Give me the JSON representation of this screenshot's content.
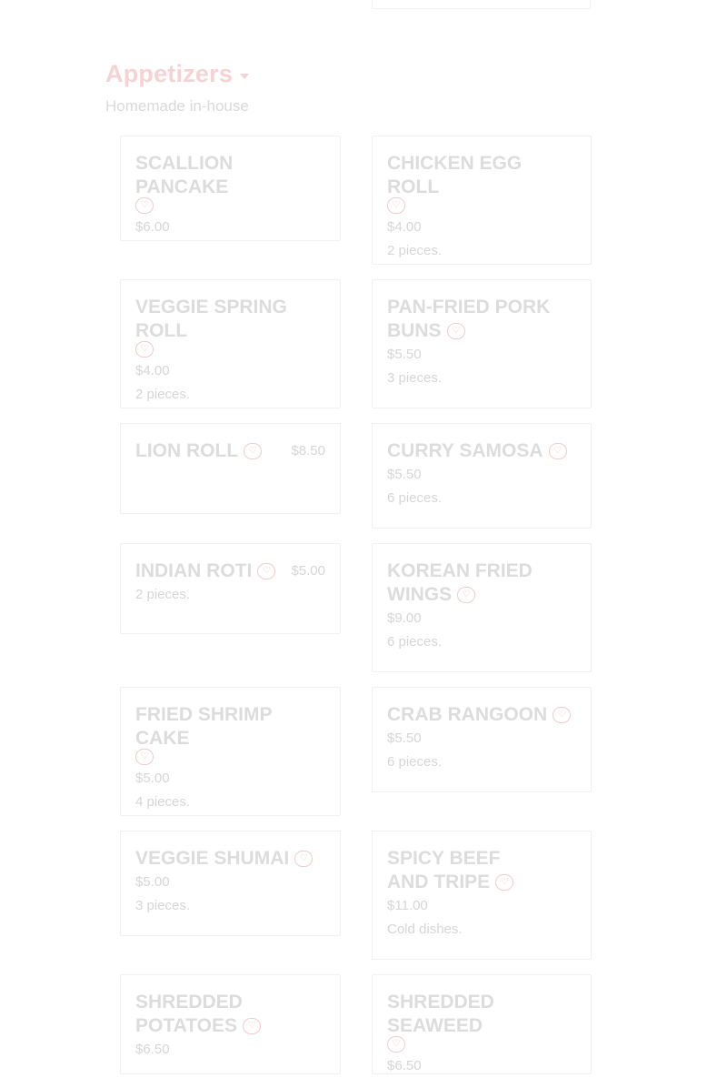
{
  "section": {
    "title": "Appetizers",
    "subtitle": "Homemade in-house"
  },
  "items": [
    {
      "name": "SCALLION PANCAKE",
      "price": "$6.00",
      "desc": ""
    },
    {
      "name": "CHICKEN EGG ROLL",
      "price": "$4.00",
      "desc": "2 pieces."
    },
    {
      "name": "VEGGIE SPRING ROLL",
      "price": "$4.00",
      "desc": "2 pieces."
    },
    {
      "name": "PAN-FRIED PORK BUNS",
      "price": "$5.50",
      "desc": "3 pieces."
    },
    {
      "name": "LION ROLL",
      "price": "$8.50",
      "desc": ""
    },
    {
      "name": "CURRY SAMOSA",
      "price": "$5.50",
      "desc": "6 pieces."
    },
    {
      "name": "INDIAN ROTI",
      "price": "$5.00",
      "desc": "2 pieces."
    },
    {
      "name": "KOREAN FRIED WINGS",
      "price": "$9.00",
      "desc": "6 pieces."
    },
    {
      "name": "FRIED SHRIMP CAKE",
      "price": "$5.00",
      "desc": "4 pieces."
    },
    {
      "name": "CRAB RANGOON",
      "price": "$5.50",
      "desc": "6 pieces."
    },
    {
      "name": "VEGGIE SHUMAI",
      "price": "$5.00",
      "desc": "3 pieces."
    },
    {
      "name": "SPICY BEEF AND TRIPE",
      "price": "$11.00",
      "desc": "Cold dishes."
    },
    {
      "name": "SHREDDED POTATOES",
      "price": "$6.50",
      "desc": ""
    },
    {
      "name": "SHREDDED SEAWEED",
      "price": "$6.50",
      "desc": ""
    }
  ],
  "icons": {
    "favorite": "heart-outline-icon",
    "dropdown": "caret-down-icon"
  },
  "colors": {
    "accent": "#f5d3d3",
    "text": "#dcdcdc",
    "border": "#f0f0f0"
  }
}
